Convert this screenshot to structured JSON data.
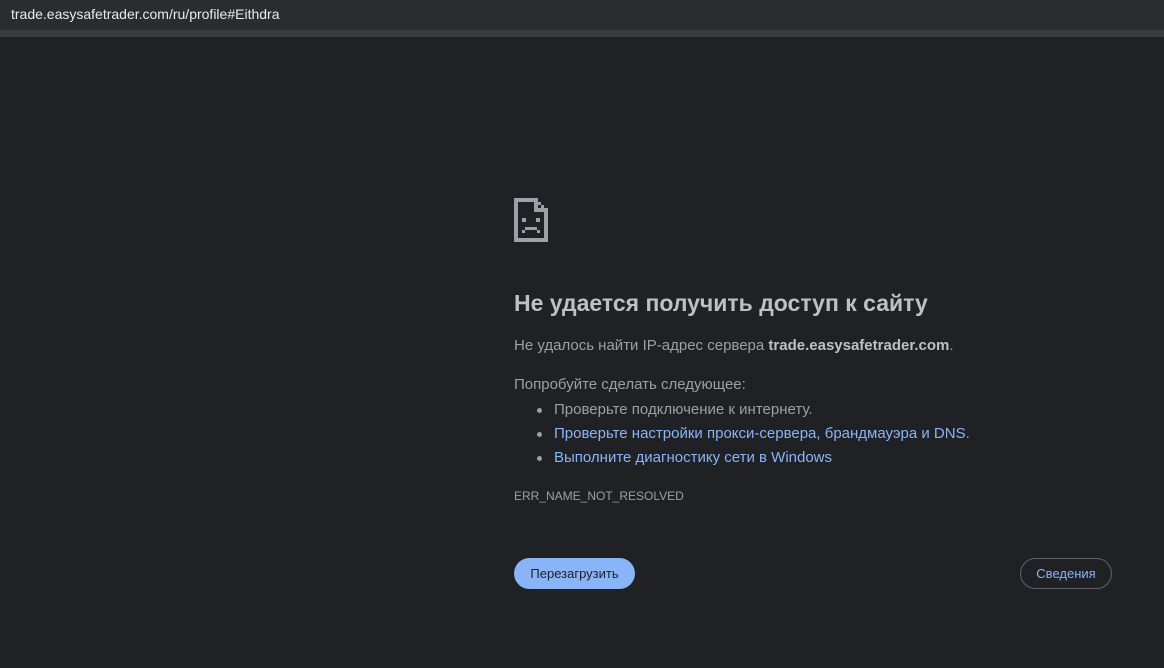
{
  "address_bar": {
    "url": "trade.easysafetrader.com/ru/profile#Eithdra"
  },
  "error_page": {
    "icon": "sad-page-icon",
    "title": "Не удается получить доступ к сайту",
    "description_prefix": "Не удалось найти IP-адрес сервера ",
    "description_host": "trade.easysafetrader.com",
    "description_suffix": ".",
    "try_heading": "Попробуйте сделать следующее:",
    "suggestions": [
      {
        "text": "Проверьте подключение к интернету.",
        "is_link": false
      },
      {
        "text": "Проверьте настройки прокси-сервера, брандмауэра и DNS",
        "suffix": ".",
        "is_link": true
      },
      {
        "text": "Выполните диагностику сети в Windows",
        "is_link": true
      }
    ],
    "error_code": "ERR_NAME_NOT_RESOLVED",
    "reload_button": "Перезагрузить",
    "details_button": "Сведения"
  },
  "colors": {
    "background": "#202124",
    "title": "#bdc1c6",
    "text": "#9aa0a6",
    "link": "#8ab4f8",
    "button_primary": "#8ab4f8"
  }
}
